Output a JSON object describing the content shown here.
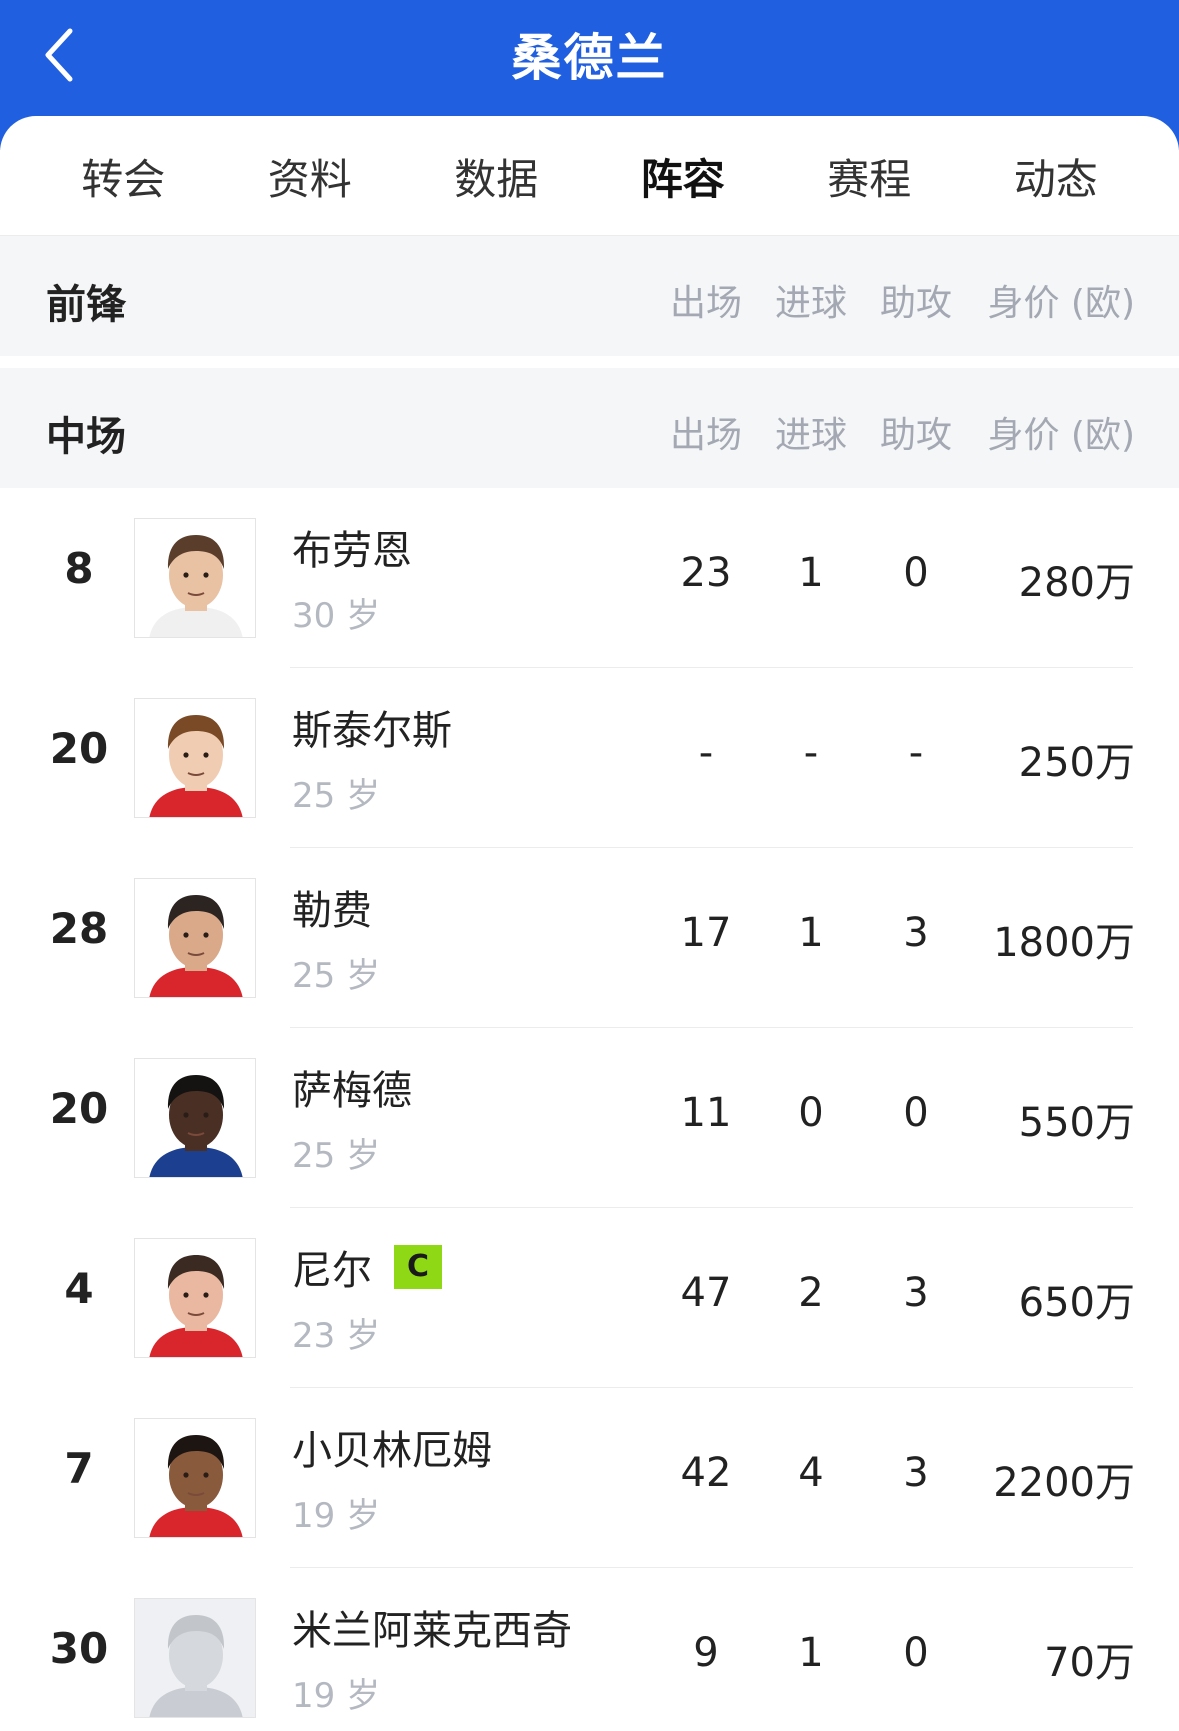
{
  "header": {
    "title": "桑德兰",
    "back_icon": "chevron-left-icon"
  },
  "tabs": [
    {
      "label": "转会"
    },
    {
      "label": "资料"
    },
    {
      "label": "数据"
    },
    {
      "label": "阵容",
      "active": true
    },
    {
      "label": "赛程"
    },
    {
      "label": "动态"
    }
  ],
  "columns": {
    "apps": "出场",
    "goals": "进球",
    "assists": "助攻",
    "value": "身价 (欧)"
  },
  "sections": {
    "forwards": {
      "title": "前锋"
    },
    "midfield": {
      "title": "中场"
    }
  },
  "players": [
    {
      "number": "8",
      "name": "布劳恩",
      "age": "30 岁",
      "apps": "23",
      "goals": "1",
      "assists": "0",
      "value": "280万",
      "jersey": "#f0f0f0",
      "skin": "#e9c2a4",
      "hair": "#5a3e2b",
      "captain": ""
    },
    {
      "number": "20",
      "name": "斯泰尔斯",
      "age": "25 岁",
      "apps": "-",
      "goals": "-",
      "assists": "-",
      "value": "250万",
      "jersey": "#d8262c",
      "skin": "#f0cdb2",
      "hair": "#7a4a26",
      "captain": ""
    },
    {
      "number": "28",
      "name": "勒费",
      "age": "25 岁",
      "apps": "17",
      "goals": "1",
      "assists": "3",
      "value": "1800万",
      "jersey": "#d8262c",
      "skin": "#d9a98a",
      "hair": "#2b2421",
      "captain": ""
    },
    {
      "number": "20",
      "name": "萨梅德",
      "age": "25 岁",
      "apps": "11",
      "goals": "0",
      "assists": "0",
      "value": "550万",
      "jersey": "#1d3f8f",
      "skin": "#4a2f24",
      "hair": "#151212",
      "captain": ""
    },
    {
      "number": "4",
      "name": "尼尔",
      "age": "23 岁",
      "apps": "47",
      "goals": "2",
      "assists": "3",
      "value": "650万",
      "jersey": "#d8262c",
      "skin": "#eab8a0",
      "hair": "#3a2a22",
      "captain": "C"
    },
    {
      "number": "7",
      "name": "小贝林厄姆",
      "age": "19 岁",
      "apps": "42",
      "goals": "4",
      "assists": "3",
      "value": "2200万",
      "jersey": "#d8262c",
      "skin": "#8a5a3c",
      "hair": "#1c1512",
      "captain": ""
    },
    {
      "number": "30",
      "name": "米兰阿莱克西奇",
      "age": "19 岁",
      "apps": "9",
      "goals": "1",
      "assists": "0",
      "value": "70万",
      "jersey": "#c9ccd2",
      "skin": "#d5d8dc",
      "hair": "#c2c5ca",
      "captain": "",
      "placeholder": true
    }
  ],
  "colors": {
    "accent": "#1f5fe0",
    "captain_badge": "#8fd816"
  }
}
